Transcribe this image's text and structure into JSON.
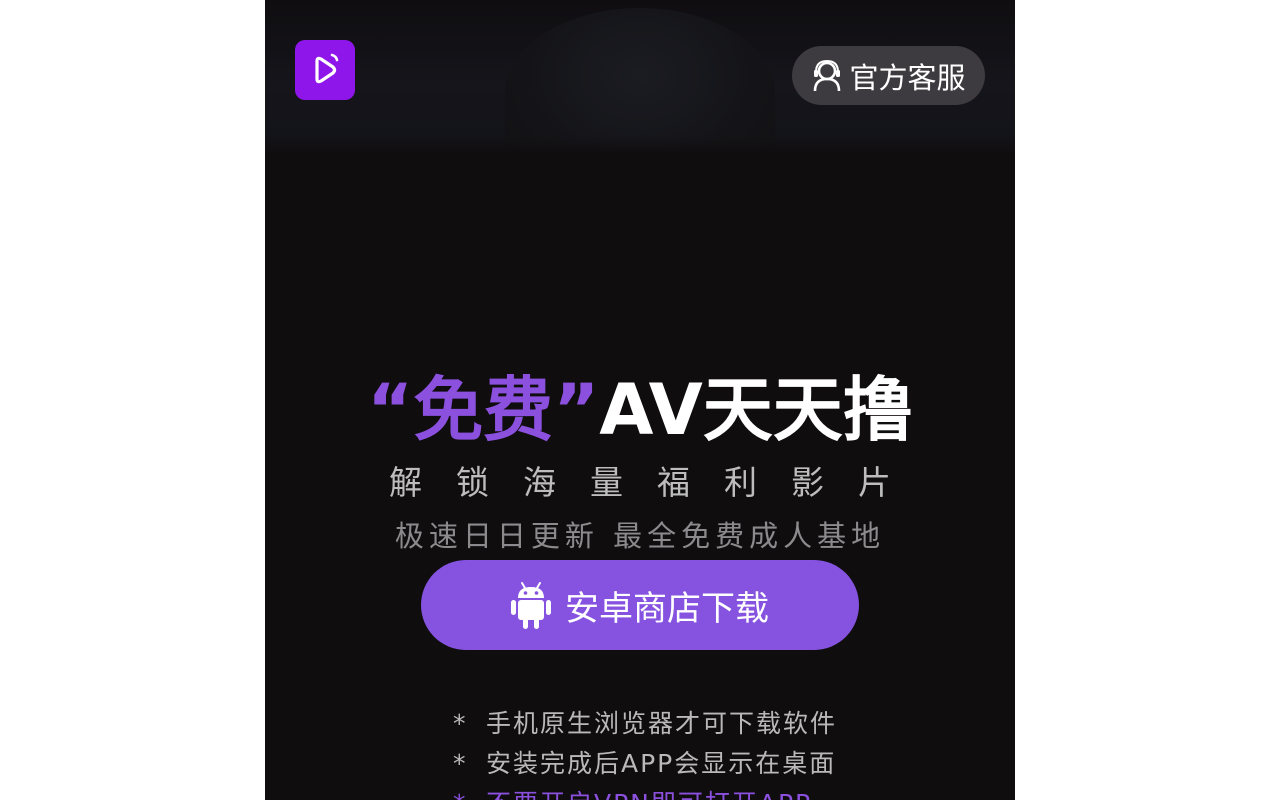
{
  "header": {
    "logo_icon": "play-logo-icon",
    "service_button_label": "官方客服",
    "service_icon": "customer-service-icon"
  },
  "headline": {
    "open_quote": "“",
    "accent": "免费",
    "close_quote": "”",
    "rest": "AV天天撸"
  },
  "subtitle_1": "解锁海量福利影片",
  "subtitle_2": "极速日日更新 最全免费成人基地",
  "download_button": {
    "label": "安卓商店下载",
    "icon": "android-icon"
  },
  "tips": [
    {
      "bullet": "*",
      "text": "手机原生浏览器才可下载软件"
    },
    {
      "bullet": "*",
      "text": "安装完成后APP会显示在桌面"
    },
    {
      "bullet": "*",
      "text": "不要开启VPN即可打开APP"
    }
  ],
  "colors": {
    "brand_purple": "#8e16ea",
    "accent_purple": "#8b50de",
    "button_purple": "#8653e1",
    "background": "#100d0f"
  }
}
